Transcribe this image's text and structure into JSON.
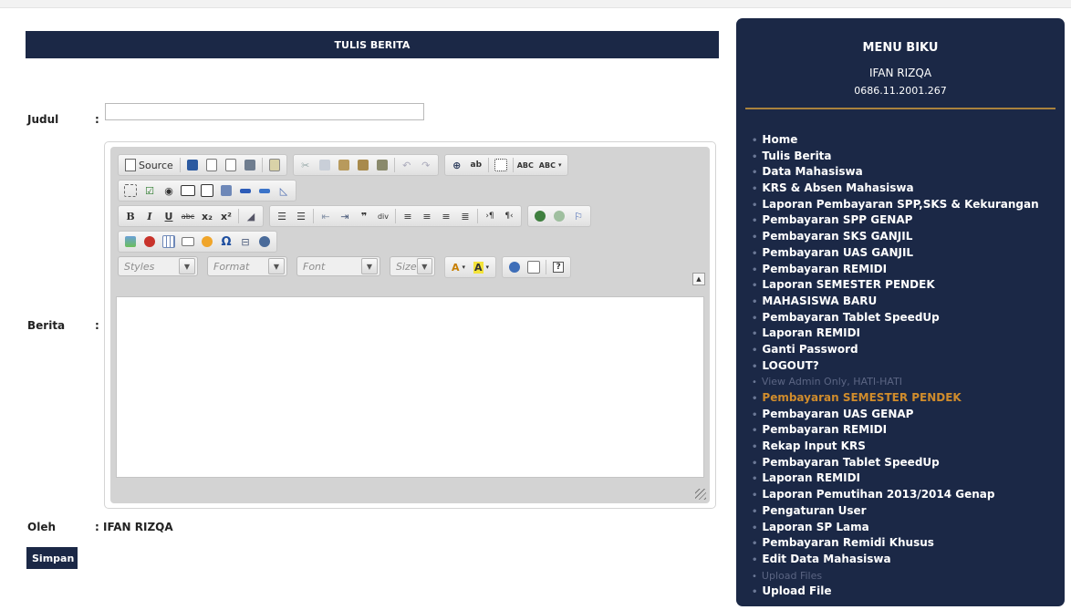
{
  "form": {
    "header": "TULIS BERITA",
    "judul_label": "Judul",
    "berita_label": "Berita",
    "oleh_label": "Oleh",
    "colon": ":",
    "oleh_value": ": IFAN RIZQA",
    "judul_value": "",
    "submit_label": "Simpan"
  },
  "editor": {
    "source_label": "Source",
    "combos": {
      "styles": "Styles",
      "format": "Format",
      "font": "Font",
      "size": "Size"
    },
    "content": ""
  },
  "sidebar": {
    "title": "MENU BIKU",
    "user_name": "IFAN RIZQA",
    "user_id": "0686.11.2001.267",
    "items": [
      {
        "label": "Home",
        "state": "normal"
      },
      {
        "label": "Tulis Berita",
        "state": "normal"
      },
      {
        "label": "Data Mahasiswa",
        "state": "normal"
      },
      {
        "label": "KRS & Absen Mahasiswa",
        "state": "normal"
      },
      {
        "label": "Laporan Pembayaran SPP,SKS & Kekurangan",
        "state": "normal"
      },
      {
        "label": "Pembayaran SPP GENAP",
        "state": "normal"
      },
      {
        "label": "Pembayaran SKS GANJIL",
        "state": "normal"
      },
      {
        "label": "Pembayaran UAS GANJIL",
        "state": "normal"
      },
      {
        "label": "Pembayaran REMIDI",
        "state": "normal"
      },
      {
        "label": "Laporan SEMESTER PENDEK",
        "state": "normal"
      },
      {
        "label": "MAHASISWA BARU",
        "state": "normal"
      },
      {
        "label": "Pembayaran Tablet SpeedUp",
        "state": "normal"
      },
      {
        "label": "Laporan REMIDI",
        "state": "normal"
      },
      {
        "label": "Ganti Password",
        "state": "normal"
      },
      {
        "label": "LOGOUT?",
        "state": "normal"
      },
      {
        "label": "View Admin Only, HATI-HATI",
        "state": "muted"
      },
      {
        "label": "Pembayaran SEMESTER PENDEK",
        "state": "active"
      },
      {
        "label": "Pembayaran UAS GENAP",
        "state": "normal"
      },
      {
        "label": "Pembayaran REMIDI",
        "state": "normal"
      },
      {
        "label": "Rekap Input KRS",
        "state": "normal"
      },
      {
        "label": "Pembayaran Tablet SpeedUp",
        "state": "normal"
      },
      {
        "label": "Laporan REMIDI",
        "state": "normal"
      },
      {
        "label": "Laporan Pemutihan 2013/2014 Genap",
        "state": "normal"
      },
      {
        "label": "Pengaturan User",
        "state": "normal"
      },
      {
        "label": "Laporan SP Lama",
        "state": "normal"
      },
      {
        "label": "Pembayaran Remidi Khusus",
        "state": "normal"
      },
      {
        "label": "Edit Data Mahasiswa",
        "state": "normal"
      },
      {
        "label": "Upload Files",
        "state": "muted"
      },
      {
        "label": "Upload File",
        "state": "normal"
      }
    ]
  },
  "colors": {
    "navy": "#1b2846",
    "accent": "#d08c2c",
    "divider": "#a9823d"
  }
}
